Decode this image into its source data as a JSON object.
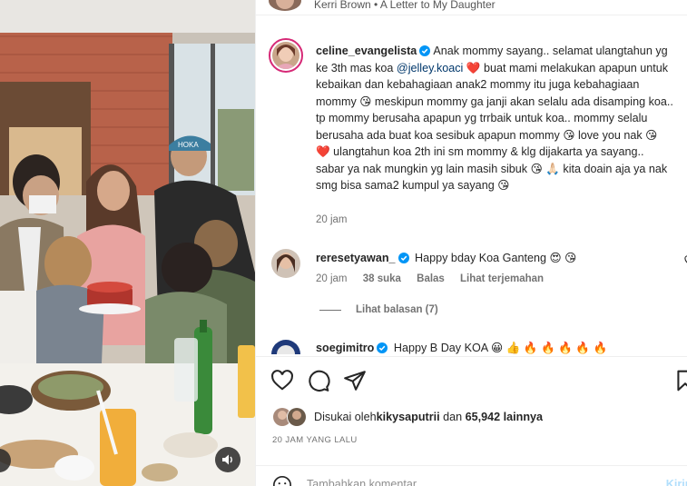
{
  "header": {
    "text": "Kerri Brown • A Letter to My Daughter"
  },
  "post": {
    "username": "celine_evangelista",
    "caption_parts": [
      "Anak mommy sayang.. selamat ulangtahun yg ke 3th mas koa ",
      "@jelley.koaci",
      " ❤️ buat mami melakukan apapun untuk kebaikan dan kebahagiaan anak2 mommy itu juga kebahagiaan mommy 😘 meskipun mommy ga janji akan selalu ada disamping koa.. tp mommy berusaha apapun yg trrbaik untuk koa.. mommy selalu berusaha ada buat koa sesibuk apapun mommy 😘 love you nak 😘 ❤️ ulangtahun koa 2th ini sm mommy & klg dijakarta ya sayang.. sabar ya nak mungkin yg lain masih sibuk 😘 🙏🏻 kita doain aja ya nak smg bisa sama2 kumpul ya sayang 😘"
    ],
    "time": "20 jam"
  },
  "comments": [
    {
      "username": "reresetyawan_",
      "text": "Happy bday Koa Ganteng 😍 😘",
      "time": "20 jam",
      "likes": "38 suka",
      "reply": "Balas",
      "translate": "Lihat terjemahan",
      "view_replies": "Lihat balasan (7)"
    },
    {
      "username": "soegimitro",
      "text": "Happy B Day KOA 😀 👍 🔥 🔥 🔥 🔥 🔥"
    }
  ],
  "likes": {
    "prefix": "Disukai oleh ",
    "user": "kikysaputrii",
    "middle": " dan ",
    "count": "65,942 lainnya"
  },
  "date": "20 JAM YANG LALU",
  "add_comment": {
    "placeholder": "Tambahkan komentar...",
    "post_label": "Kirim"
  },
  "icons": {
    "like": "heart-icon",
    "comment": "comment-icon",
    "share": "share-icon",
    "save": "bookmark-icon",
    "volume": "volume-icon",
    "verified": "verified-badge-icon",
    "emoji": "smile-icon"
  },
  "colors": {
    "mention": "#00376b",
    "verified": "#0095f6",
    "muted": "#737373",
    "post_button": "#b2dffc"
  }
}
